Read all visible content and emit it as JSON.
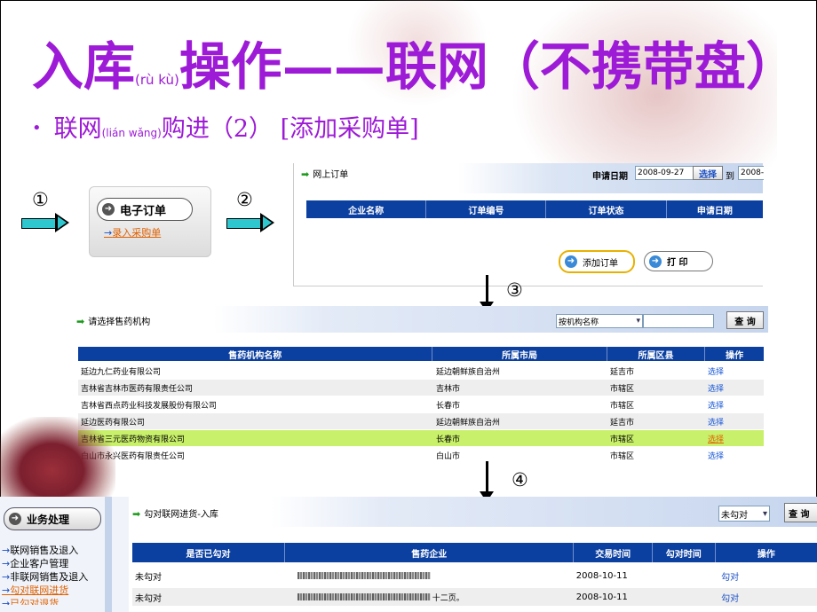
{
  "slide": {
    "title_main": "入库",
    "title_pinyin1": "(rù kù)",
    "title_rest": "操作——联网（不携带盘）",
    "bullet_dot": "•",
    "bullet_main": "联网",
    "bullet_pinyin": "(lián wǎng)",
    "bullet_rest": "购进（2） [添加采购单]",
    "step1": "①",
    "step2": "②",
    "step3": "③",
    "step4": "④",
    "footer_note": "十二页。"
  },
  "menu": {
    "button_label": "电子订单",
    "link_label": "录入采购单"
  },
  "order_panel": {
    "title": "网上订单",
    "date_label": "申请日期",
    "date_from": "2008-09-27",
    "select_label": "选择",
    "to_label": "到",
    "date_to": "2008-",
    "columns": [
      "企业名称",
      "订单编号",
      "订单状态",
      "申请日期"
    ],
    "add_button": "添加订单",
    "print_button": "打 印"
  },
  "org_panel": {
    "title": "请选择售药机构",
    "filter_select": "按机构名称",
    "query_button": "查 询",
    "columns": [
      "售药机构名称",
      "所属市局",
      "所属区县",
      "操作"
    ],
    "rows": [
      [
        "延边九仁药业有限公司",
        "延边朝鲜族自治州",
        "延吉市",
        "选择"
      ],
      [
        "吉林省吉林市医药有限责任公司",
        "吉林市",
        "市辖区",
        "选择"
      ],
      [
        "吉林省西点药业科技发展股份有限公司",
        "长春市",
        "市辖区",
        "选择"
      ],
      [
        "延边医药有限公司",
        "延边朝鲜族自治州",
        "延吉市",
        "选择"
      ],
      [
        "吉林省三元医药物资有限公司",
        "长春市",
        "市辖区",
        "选择"
      ],
      [
        "白山市永兴医药有限责任公司",
        "白山市",
        "市辖区",
        "选择"
      ]
    ],
    "highlighted_row": 4,
    "colors": {
      "header": "#0b3fa0",
      "highlight": "#c8f06a",
      "alt_row": "#eeeeee"
    }
  },
  "sidebar": {
    "header": "业务处理",
    "items": [
      "联网销售及退入",
      "企业客户管理",
      "非联网销售及退入",
      "勾对联网进货",
      "已勾对退货"
    ],
    "active_item": 3
  },
  "check_panel": {
    "title": "勾对联网进货-入库",
    "filter_select": "未勾对",
    "query_button": "查 询",
    "columns": [
      "是否已勾对",
      "售药企业",
      "交易时间",
      "勾对时间",
      "操作"
    ],
    "rows": [
      [
        "未勾对",
        "",
        "2008-10-11",
        "",
        "勾对"
      ],
      [
        "未勾对",
        "",
        "2008-10-11",
        "",
        "勾对"
      ]
    ]
  }
}
